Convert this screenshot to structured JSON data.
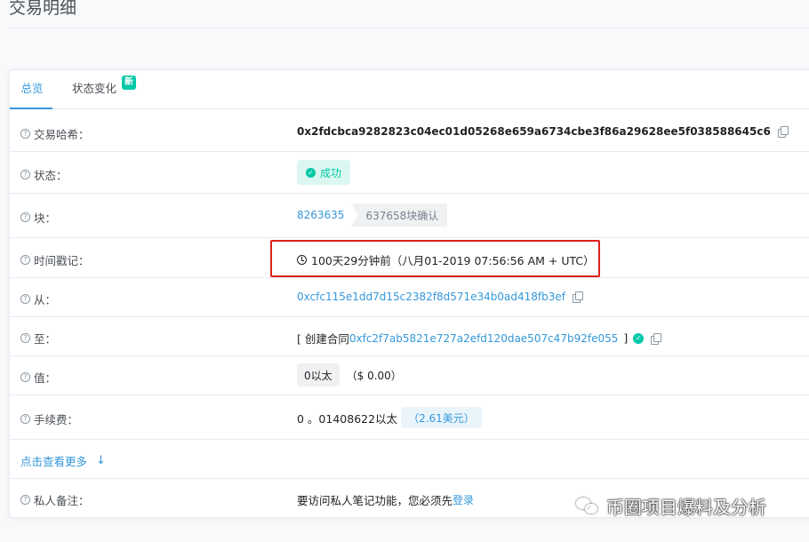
{
  "page": {
    "title": "交易明细"
  },
  "tabs": [
    {
      "label": "总览"
    },
    {
      "label": "状态变化",
      "badge": "新"
    }
  ],
  "rows": {
    "tx_hash": {
      "label": "交易哈希：",
      "value": "0x2fdcbca9282823c04ec01d05268e659a6734cbe3f86a29628ee5f038588645c6"
    },
    "status": {
      "label": "状态：",
      "value": "成功"
    },
    "block": {
      "label": "块：",
      "value": "8263635",
      "confirmations": "637658块确认"
    },
    "timestamp": {
      "label": "时间戳记：",
      "value": "100天29分钟前（八月01-2019 07:56:56 AM + UTC）"
    },
    "from": {
      "label": "从：",
      "value": "0xcfc115e1dd7d15c2382f8d571e34b0ad418fb3ef"
    },
    "to": {
      "label": "至：",
      "prefix": "[ 创建合同",
      "value": "0xfc2f7ab5821e727a2efd120dae507c47b92fe055",
      "suffix": "]"
    },
    "value": {
      "label": "值：",
      "value": "0以太",
      "usd": "（$ 0.00）"
    },
    "fee": {
      "label": "手续费：",
      "value": "0 。01408622以太",
      "usd": "（2.61美元）"
    },
    "more": {
      "label": "点击查看更多"
    },
    "private_note": {
      "label": "私人备注：",
      "text": "要访问私人笔记功能，您必须先",
      "link": "登录"
    }
  },
  "icons": {
    "help": "question-circle",
    "copy": "copy",
    "success": "check-circle",
    "clock": "clock",
    "verified": "check-circle",
    "expand": "arrow-down"
  },
  "colors": {
    "accent": "#3498db",
    "success": "#00c9a7",
    "highlight_box": "#e0201b"
  },
  "watermark": {
    "text": "币圈项目爆料及分析"
  }
}
